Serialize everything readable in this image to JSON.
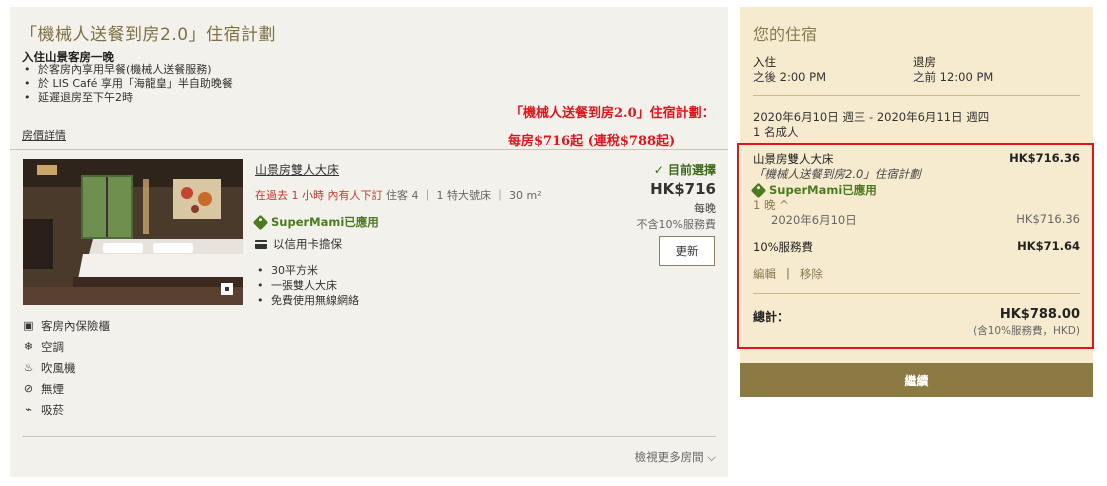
{
  "plan": {
    "title": "「機械人送餐到房2.0」住宿計劃",
    "stay_heading": "入住山景客房一晚",
    "inclusions": [
      "於客房內享用早餐(機械人送餐服務)",
      "於 LIS Café 享用「海龍皇」半自助晚餐",
      "延遲退房至下午2時"
    ],
    "rate_details_link": "房價詳情"
  },
  "annotation": {
    "line1": "「機械人送餐到房2.0」住宿計劃：",
    "line2": "每房$716起 (連稅$788起)"
  },
  "room": {
    "name": "山景房雙人大床",
    "recent_booking_prefix": "在過去 1 小時 內有人下訂",
    "meta": "住客 4 ｜ 1 特大號床 ｜ 30 m²",
    "promo": "SuperMami已應用",
    "guarantee": "以信用卡擔保",
    "features": [
      "30平方米",
      "一張雙人大床",
      "免費使用無線網絡"
    ],
    "selected_label": "✓ 目前選擇",
    "price": "HK$716",
    "per_night": "每晚",
    "excl_service": "不含10%服務費",
    "update_button": "更新"
  },
  "amenities": [
    {
      "icon": "safe-icon",
      "glyph": "▣",
      "label": "客房內保險櫃"
    },
    {
      "icon": "air-conditioning-icon",
      "glyph": "❄",
      "label": "空調"
    },
    {
      "icon": "hair-dryer-icon",
      "glyph": "♨",
      "label": "吹風機"
    },
    {
      "icon": "no-smoking-icon",
      "glyph": "⊘",
      "label": "無煙"
    },
    {
      "icon": "smoking-icon",
      "glyph": "⌁",
      "label": "吸菸"
    }
  ],
  "more_rooms_link": "檢視更多房間 ⌵",
  "summary": {
    "title": "您的住宿",
    "checkin_label": "入住",
    "checkin_value": "之後 2:00 PM",
    "checkout_label": "退房",
    "checkout_value": "之前 12:00 PM",
    "dates": "2020年6月10日 週三 - 2020年6月11日 週四",
    "guests": "1 名成人",
    "room_name": "山景房雙人大床",
    "room_price": "HK$716.36",
    "plan_name": "「機械人送餐到房2.0」住宿計劃",
    "promo": "SuperMami已應用",
    "nights_toggle": "1 晚 ^",
    "night_date": "2020年6月10日",
    "night_price": "HK$716.36",
    "service_label": "10%服務費",
    "service_price": "HK$71.64",
    "edit_link": "編輯",
    "remove_link": "移除",
    "total_label": "總計：",
    "total_price": "HK$788.00",
    "total_note": "(含10%服務費，HKD)",
    "continue_button": "繼續"
  },
  "colors": {
    "accent_gold": "#8c7a45",
    "summary_bg": "#f7ebcf",
    "panel_bg": "#f3f1ec",
    "promo_green": "#4c7a1f",
    "highlight_red": "#e0151c"
  }
}
